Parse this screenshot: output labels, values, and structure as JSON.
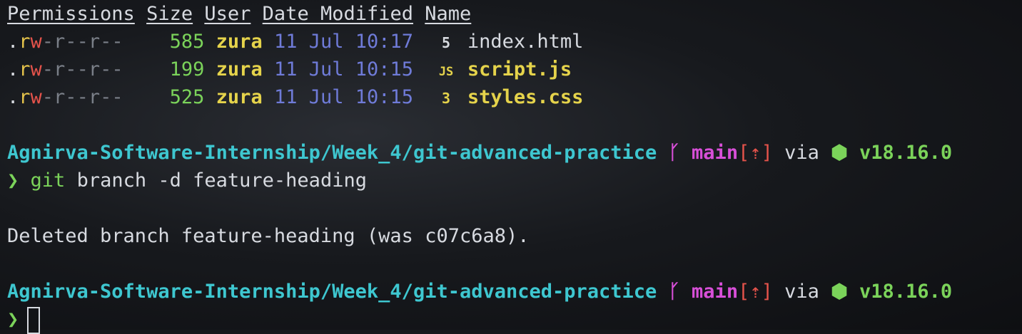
{
  "listing": {
    "headers": [
      "Permissions",
      "Size",
      "User",
      "Date Modified",
      "Name"
    ],
    "rows": [
      {
        "perm_dot": ".",
        "perm_r1": "r",
        "perm_w1": "w",
        "perm_rest": "-r--r--",
        "size": "585",
        "user": "zura",
        "date": "11 Jul 10:17",
        "icon": "html5-icon",
        "name": "index.html"
      },
      {
        "perm_dot": ".",
        "perm_r1": "r",
        "perm_w1": "w",
        "perm_rest": "-r--r--",
        "size": "199",
        "user": "zura",
        "date": "11 Jul 10:15",
        "icon": "javascript-icon",
        "name": "script.js"
      },
      {
        "perm_dot": ".",
        "perm_r1": "r",
        "perm_w1": "w",
        "perm_rest": "-r--r--",
        "size": "525",
        "user": "zura",
        "date": "11 Jul 10:15",
        "icon": "css3-icon",
        "name": "styles.css"
      }
    ]
  },
  "prompt1": {
    "path": "Agnirva-Software-Internship/Week_4/git-advanced-practice",
    "branch_glyph": "ᚴ",
    "branch": "main",
    "ahead_open": "[",
    "ahead_arrow": "⇡",
    "ahead_close": "]",
    "via": "via",
    "node_glyph": "⬢",
    "node_version": "v18.16.0"
  },
  "command1": {
    "prompt_char": "❯",
    "git": "git",
    "args": "branch -d feature-heading"
  },
  "output1": "Deleted branch feature-heading (was c07c6a8).",
  "prompt2": {
    "path": "Agnirva-Software-Internship/Week_4/git-advanced-practice",
    "branch_glyph": "ᚴ",
    "branch": "main",
    "ahead_open": "[",
    "ahead_arrow": "⇡",
    "ahead_close": "]",
    "via": "via",
    "node_glyph": "⬢",
    "node_version": "v18.16.0"
  },
  "command2": {
    "prompt_char": "❯"
  },
  "icons": {
    "html": "5",
    "js": "JS",
    "css": "3"
  }
}
